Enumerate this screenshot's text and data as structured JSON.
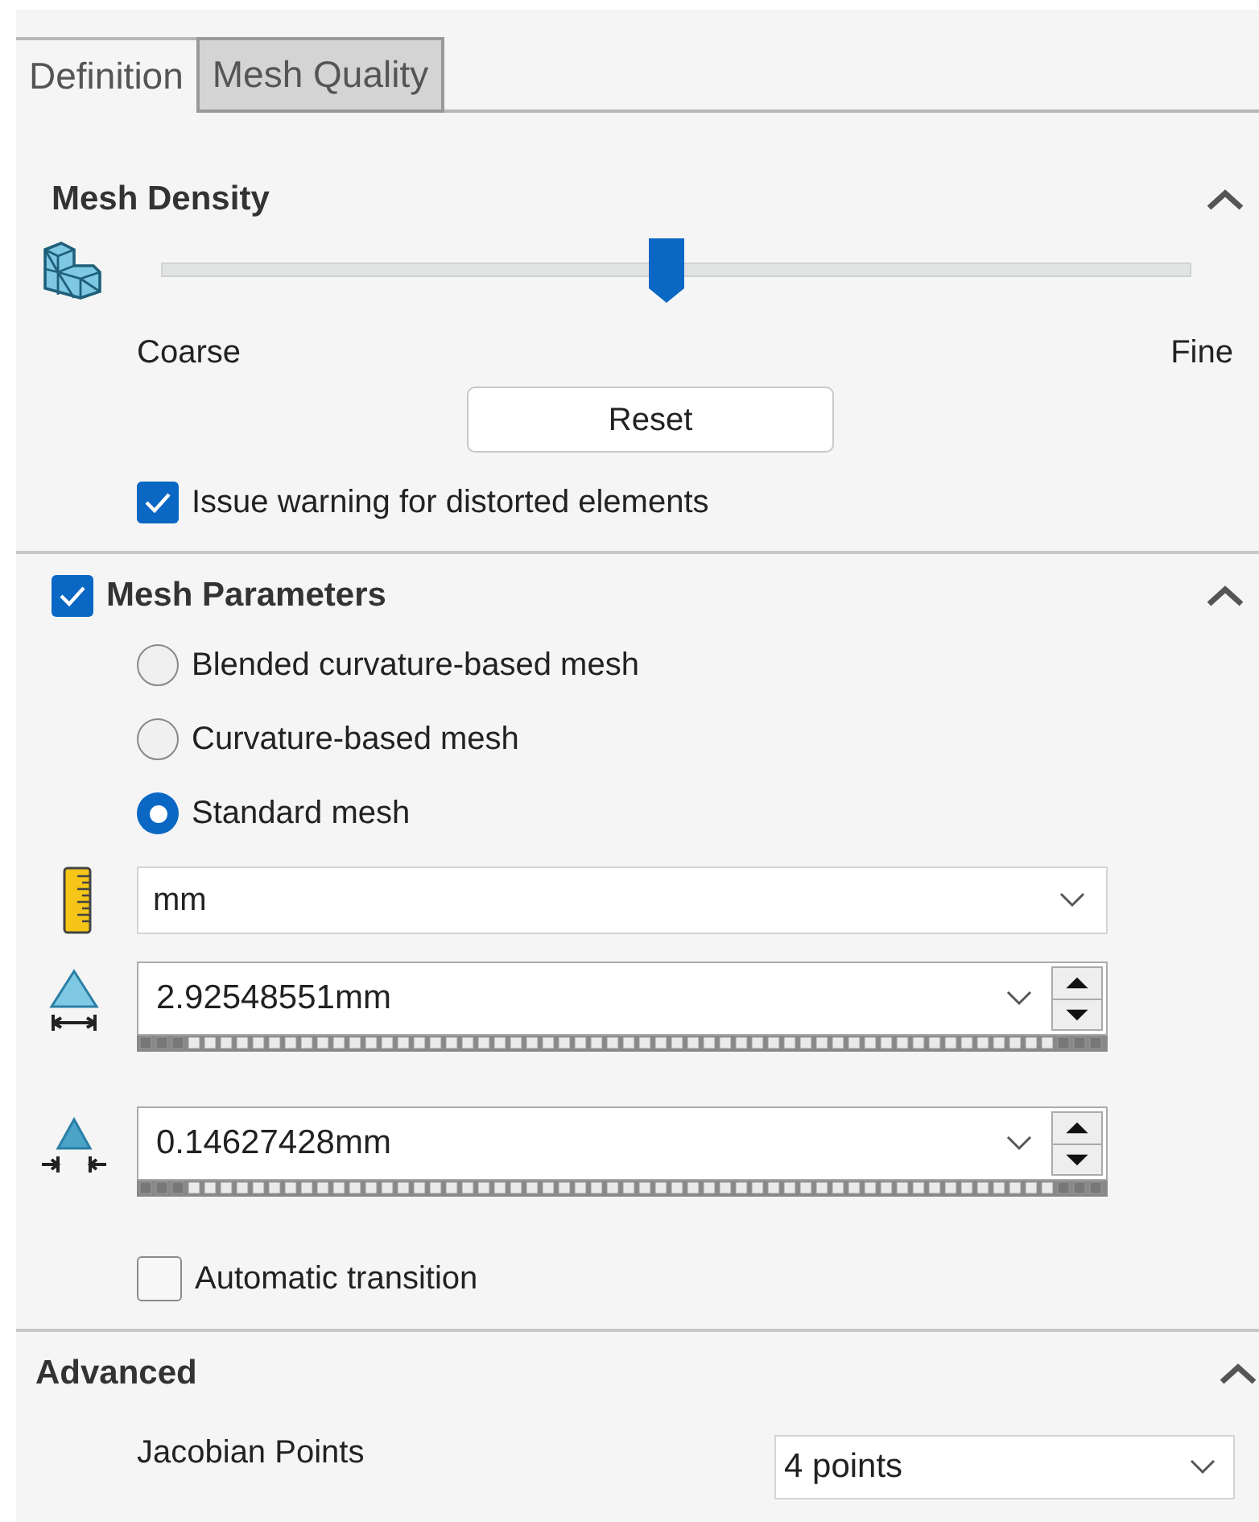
{
  "tabs": [
    {
      "label": "Definition",
      "selected": true
    },
    {
      "label": "Mesh Quality",
      "selected": false
    }
  ],
  "mesh_density": {
    "title": "Mesh Density",
    "expanded": true,
    "level": 0.49,
    "min_label": "Coarse",
    "max_label": "Fine",
    "reset_button": "Reset",
    "warning_checkbox": {
      "label": "Issue warning for distorted elements",
      "checked": true
    }
  },
  "mesh_parameters": {
    "title": "Mesh Parameters",
    "checked": true,
    "expanded": true,
    "options": [
      {
        "label": "Blended curvature-based mesh",
        "selected": false
      },
      {
        "label": "Curvature-based mesh",
        "selected": false
      },
      {
        "label": "Standard mesh",
        "selected": true
      }
    ],
    "unit": "mm",
    "fields": [
      {
        "kind": "size",
        "value": "2.92548551mm"
      },
      {
        "kind": "tolerance",
        "value": "0.14627428mm"
      }
    ],
    "automatic_transition": {
      "label": "Automatic transition",
      "checked": false
    }
  },
  "advanced": {
    "title": "Advanced",
    "expanded": true,
    "jacobian_label": "Jacobian Points",
    "jacobian_value": "4 points"
  }
}
